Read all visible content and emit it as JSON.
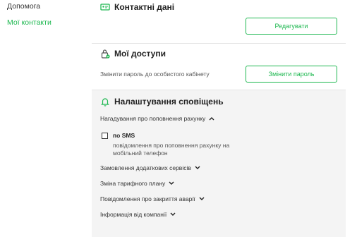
{
  "sidebar": {
    "items": [
      {
        "label": "Допомога"
      },
      {
        "label": "Мої контакти"
      }
    ]
  },
  "contacts": {
    "title": "Контактні дані",
    "icon": "contact-card-icon",
    "edit_button": "Редагувати"
  },
  "access": {
    "title": "Мої доступи",
    "icon": "lock-icon",
    "description": "Змінити пароль до особистого кабінету",
    "change_button": "Змінити пароль"
  },
  "notifications": {
    "title": "Налаштування сповіщень",
    "icon": "bell-icon",
    "sections": [
      {
        "label": "Нагадування про поповнення рахунку",
        "expanded": true
      },
      {
        "label": "Замовлення додаткових сервісів",
        "expanded": false
      },
      {
        "label": "Зміна тарифного плану",
        "expanded": false
      },
      {
        "label": "Повідомлення про закриття аварії",
        "expanded": false
      },
      {
        "label": "Інформація від компанії",
        "expanded": false
      }
    ],
    "sms": {
      "label": "по SMS",
      "checked": false,
      "description": "повідомлення про поповнення рахунку на мобільний телефон"
    }
  },
  "colors": {
    "accent": "#1fb851",
    "panel_bg": "#f4f4f4"
  }
}
